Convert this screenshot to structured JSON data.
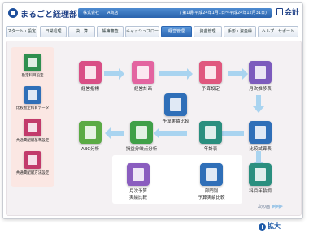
{
  "header": {
    "app_name": "まるごと経理部",
    "company_label": "株式会社",
    "company_name": "A商店",
    "period": "/ 第1期(平成24年1月1日～平成24年12月31日)",
    "module": "会計"
  },
  "nav": {
    "tabs": [
      {
        "label": "スタート・設定",
        "active": false
      },
      {
        "label": "日常処理",
        "active": false
      },
      {
        "label": "決　算",
        "active": false
      },
      {
        "label": "帳簿審査",
        "active": false
      },
      {
        "label": "キャッシュフロー",
        "active": false
      },
      {
        "label": "経営管理",
        "active": true
      },
      {
        "label": "資金管理",
        "active": false
      },
      {
        "label": "手形・資金繰",
        "active": false
      },
      {
        "label": "ヘルプ・サポート",
        "active": false
      }
    ]
  },
  "side_items": [
    {
      "label": "勘定科目設定",
      "color": "#2f8f4f"
    },
    {
      "label": "比較勘定科目データ",
      "color": "#2f6fb8"
    },
    {
      "label": "共通費配賦基準設定",
      "color": "#c23b6b"
    },
    {
      "label": "共通費配賦方法設定",
      "color": "#c23b6b"
    }
  ],
  "nodes": {
    "keiei_shihyo": {
      "label": "経営指標",
      "color": "#d94f86",
      "icon": "radar-chart-icon"
    },
    "keiei_keikaku": {
      "label": "経営計画",
      "color": "#e364a0",
      "icon": "document-icon"
    },
    "yosan_settei": {
      "label": "予算設定",
      "color": "#e0577e",
      "icon": "stack-icon"
    },
    "getsuji_suii": {
      "label": "月次推移表",
      "color": "#7c5bbd",
      "icon": "line-chart-icon"
    },
    "yosan_jisseki": {
      "label": "予算実績比較",
      "color": "#2f6fb8",
      "icon": "compare-docs-icon"
    },
    "abc": {
      "label": "ABC分析",
      "color": "#5bab45",
      "icon": "bar-chart-icon"
    },
    "sonneki": {
      "label": "損益分岐点分析",
      "color": "#3fa048",
      "icon": "shuffle-icon"
    },
    "nenkei": {
      "label": "年計表",
      "color": "#2a8f7f",
      "icon": "trend-chart-icon"
    },
    "hikaku_shisan": {
      "label": "比較試算表",
      "color": "#2f6fb8",
      "icon": "table-icon"
    },
    "getsuji_yosan": {
      "label": "月次予算\n実績比較",
      "color": "#8a5dbf",
      "icon": "chart-compare-icon"
    },
    "bumon_yosan": {
      "label": "部門別\n予算実績比較",
      "color": "#2f6fb8",
      "icon": "department-icon"
    },
    "kamoku_nenkan": {
      "label": "科目年齢調",
      "color": "#2a8f7f",
      "icon": "ledger-icon"
    }
  },
  "footer": {
    "next_label": "次の画",
    "zoom_label": "拡大"
  }
}
